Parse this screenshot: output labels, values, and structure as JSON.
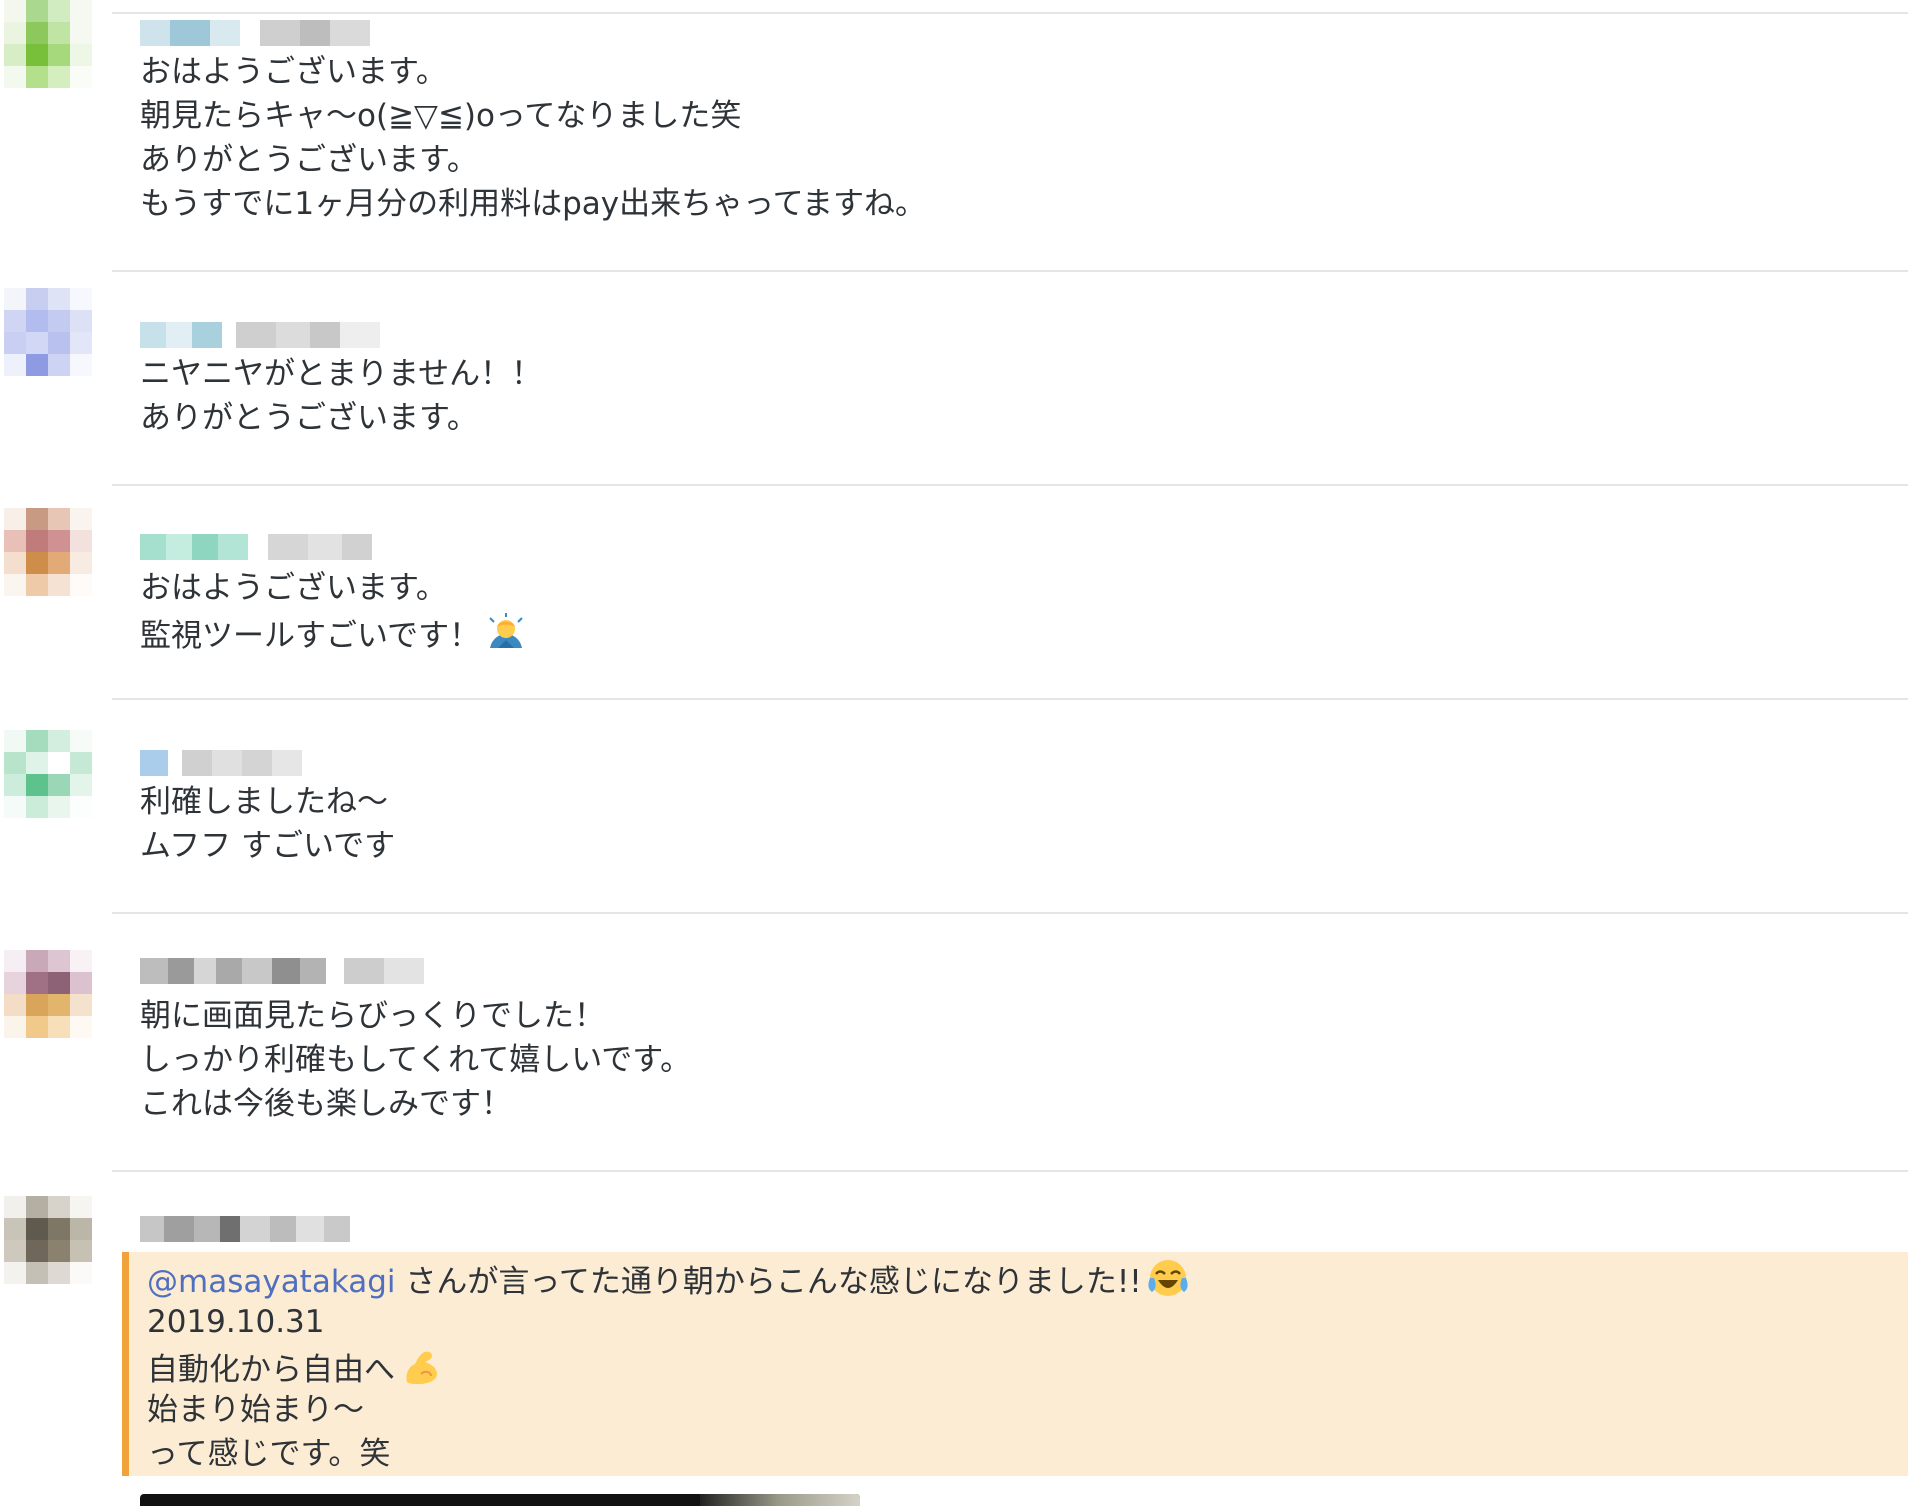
{
  "messages": [
    {
      "lines": [
        "おはようございます。",
        "朝見たらキャ〜o(≧▽≦)oってなりました笑",
        "ありがとうございます。",
        "もうすでに1ヶ月分の利用料はpay出来ちゃってますね。"
      ]
    },
    {
      "lines": [
        "ニヤニヤがとまりません！！",
        "ありがとうございます。"
      ]
    },
    {
      "lines": [
        "おはようございます。",
        "監視ツールすごいです！"
      ],
      "emoji": "man-bowing-icon"
    },
    {
      "lines": [
        "利確しましたね〜",
        "ムフフ すごいです"
      ]
    },
    {
      "lines": [
        "朝に画面見たらびっくりでした！",
        "しっかり利確もしてくれて嬉しいです。",
        "これは今後も楽しみです！"
      ]
    },
    {
      "mention": "@masayatakagi",
      "mention_rest": " さんが言ってた通り朝からこんな感じになりました!!",
      "mention_emoji": "face-with-tears-of-joy-icon",
      "lines": [
        "2019.10.31",
        "自動化から自由へ",
        "始まり始まり〜",
        "って感じです。笑"
      ],
      "line_emoji": "flexed-biceps-icon"
    }
  ],
  "colors": {
    "mention_bg": "#fdecd4",
    "mention_border": "#f0a33a",
    "mention_text": "#4f6fbf"
  }
}
